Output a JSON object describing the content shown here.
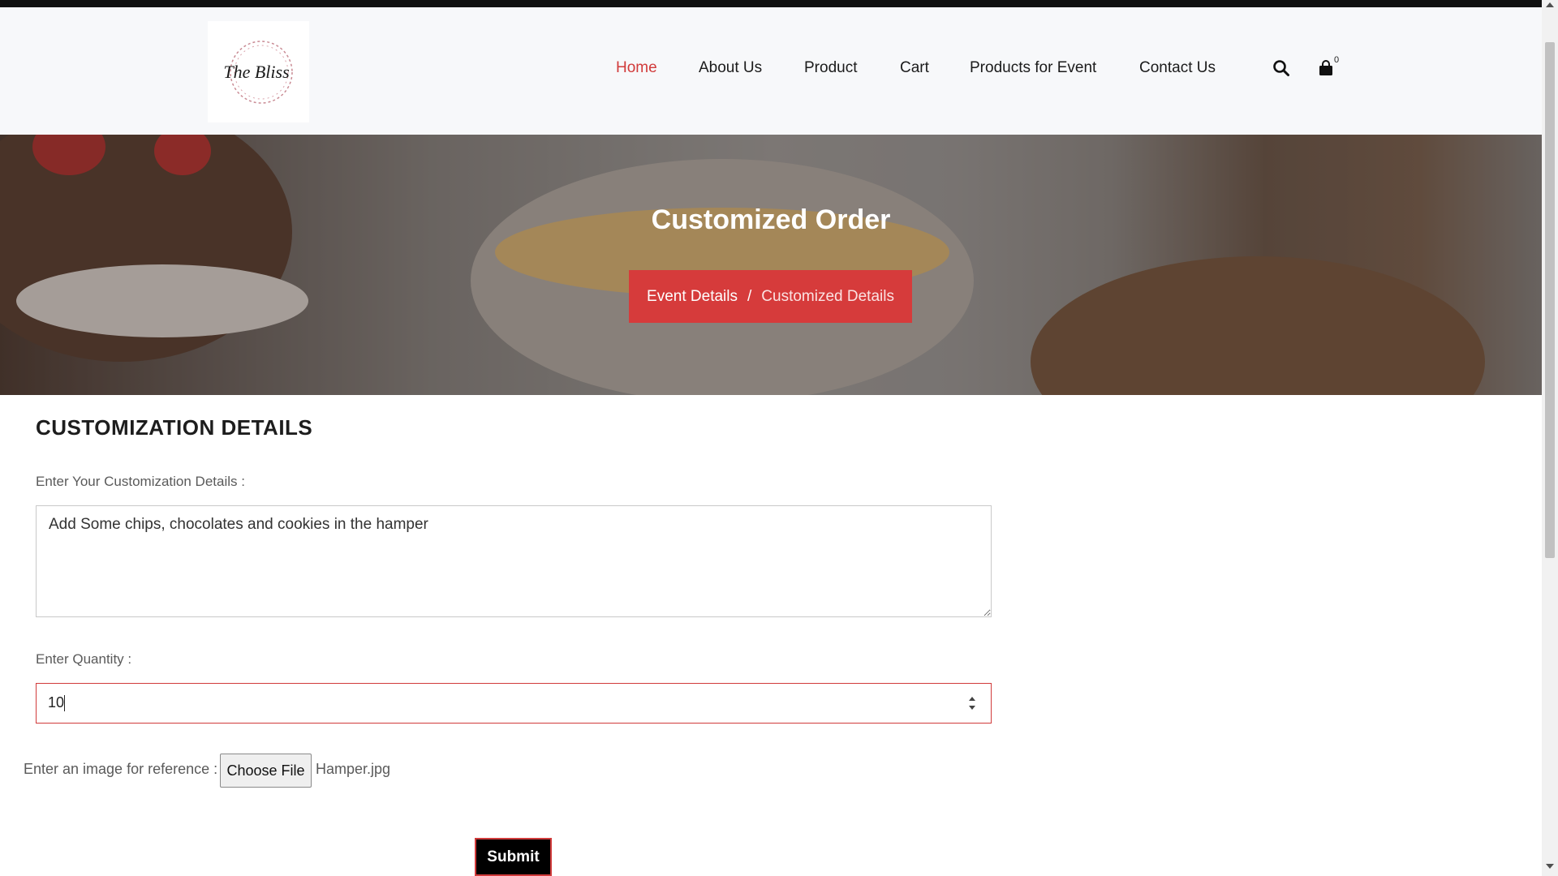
{
  "brand": {
    "logo_text": "The Bliss"
  },
  "nav": {
    "items": [
      {
        "label": "Home",
        "active": true
      },
      {
        "label": "About Us"
      },
      {
        "label": "Product"
      },
      {
        "label": "Cart"
      },
      {
        "label": "Products for Event"
      },
      {
        "label": "Contact Us"
      }
    ],
    "search_icon": "search-icon",
    "cart_icon": "shopping-bag-icon",
    "cart_count": "0"
  },
  "hero": {
    "title": "Customized Order",
    "breadcrumb": {
      "parent": "Event Details",
      "separator": "/",
      "current": "Customized Details"
    }
  },
  "form": {
    "section_title": "CUSTOMIZATION DETAILS",
    "details_label": "Enter Your Customization Details :",
    "details_value": "Add Some chips, chocolates and cookies in the hamper",
    "quantity_label": "Enter Quantity :",
    "quantity_value": "10",
    "image_label": "Enter an image for reference :",
    "file_button": "Choose File",
    "file_name": "Hamper.jpg",
    "submit_label": "Submit"
  },
  "colors": {
    "accent": "#d63b3b",
    "header_bg": "#f7f8fa",
    "text": "#1b1b1b"
  }
}
